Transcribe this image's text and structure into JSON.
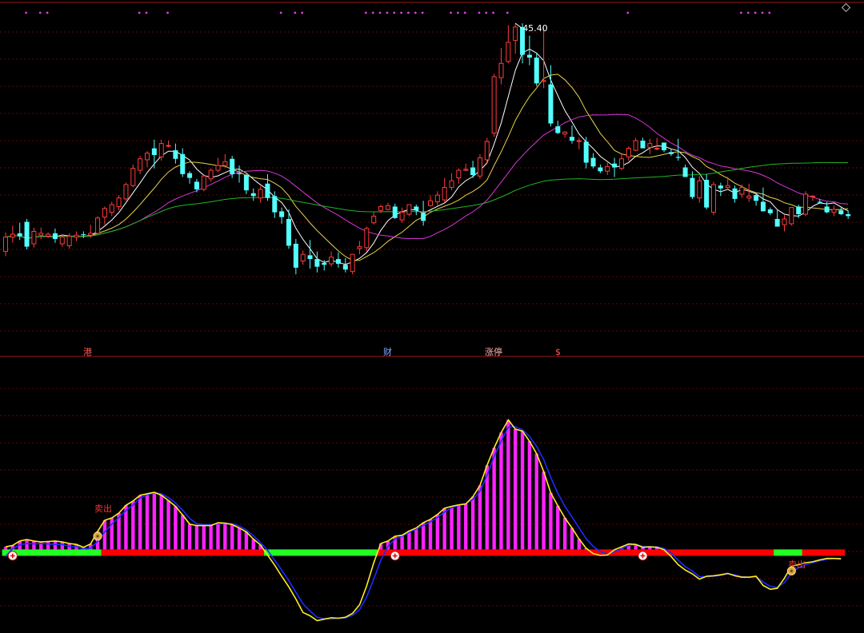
{
  "chart_data": [
    {
      "type": "candlestick",
      "panel": "price",
      "peak_label": "45.40",
      "ylim": [
        11,
        47
      ],
      "candles": [
        [
          21.5,
          23.5,
          21,
          23
        ],
        [
          23,
          24.2,
          22.4,
          23.3
        ],
        [
          23.4,
          24.5,
          22.7,
          23.1
        ],
        [
          24.6,
          24.9,
          21.7,
          22
        ],
        [
          22.3,
          24,
          21.9,
          23.6
        ],
        [
          23.2,
          24,
          22.8,
          23.4
        ],
        [
          23.1,
          23.5,
          22.9,
          23.3
        ],
        [
          23.4,
          23.9,
          22.4,
          22.8
        ],
        [
          22.3,
          23.2,
          22,
          23
        ],
        [
          22.1,
          23.4,
          21.8,
          23.1
        ],
        [
          23,
          23.6,
          22.6,
          23.2
        ],
        [
          23.3,
          23.6,
          22.9,
          23.2
        ],
        [
          23.2,
          24.3,
          22.9,
          23.4
        ],
        [
          23.4,
          25.2,
          23.3,
          25
        ],
        [
          25.1,
          26.2,
          24.3,
          26
        ],
        [
          25.6,
          26.7,
          25.2,
          26.4
        ],
        [
          26.2,
          27.4,
          25.8,
          27.1
        ],
        [
          27,
          28.7,
          26.8,
          28.5
        ],
        [
          28.4,
          30.6,
          28.2,
          30.2
        ],
        [
          30,
          31.5,
          29.6,
          31.2
        ],
        [
          31.1,
          32,
          30.3,
          31.8
        ],
        [
          32.3,
          33.2,
          30.2,
          31.6
        ],
        [
          31.4,
          33.2,
          31,
          32.8
        ],
        [
          32.6,
          33.1,
          32.4,
          32.6
        ],
        [
          32.1,
          32.8,
          30.7,
          31.2
        ],
        [
          31.7,
          32.3,
          29.3,
          29.6
        ],
        [
          29.7,
          29.9,
          28.6,
          29.2
        ],
        [
          28.8,
          29.1,
          27.7,
          28
        ],
        [
          28,
          29.6,
          27.8,
          29.4
        ],
        [
          29.1,
          30.2,
          28.8,
          30
        ],
        [
          30,
          31.3,
          29.8,
          30.5
        ],
        [
          30.5,
          31.7,
          30.3,
          30.9
        ],
        [
          31.2,
          31.5,
          29.2,
          29.6
        ],
        [
          29.7,
          30.5,
          28.7,
          29.6
        ],
        [
          29.5,
          29.6,
          27.5,
          27.9
        ],
        [
          27.6,
          28.1,
          26.8,
          27.3
        ],
        [
          27.1,
          28.3,
          26.6,
          28
        ],
        [
          28.6,
          29.6,
          26.8,
          27.1
        ],
        [
          27.3,
          27.8,
          25,
          25.6
        ],
        [
          25.7,
          26.1,
          24.4,
          25.1
        ],
        [
          24.9,
          25.9,
          21.8,
          22.1
        ],
        [
          22.3,
          22.8,
          19.1,
          19.8
        ],
        [
          20.5,
          21.6,
          20.1,
          21.2
        ],
        [
          21.1,
          22.7,
          19.7,
          20.7
        ],
        [
          20.7,
          21.5,
          19.3,
          19.9
        ],
        [
          20.3,
          20.6,
          19.5,
          20.1
        ],
        [
          20.2,
          21.5,
          19.9,
          20.9
        ],
        [
          20.7,
          21.4,
          19.8,
          20.2
        ],
        [
          20.1,
          20.8,
          19.3,
          19.6
        ],
        [
          19.4,
          21.1,
          19.1,
          21.2
        ],
        [
          21.8,
          22.6,
          21.2,
          22
        ],
        [
          21.9,
          24.1,
          21.5,
          23.9
        ],
        [
          24.5,
          25.6,
          24.3,
          25.2
        ],
        [
          25.8,
          26.4,
          25.5,
          26.2
        ],
        [
          25.9,
          26.6,
          25.8,
          26.3
        ],
        [
          26.2,
          26.5,
          24.9,
          25
        ],
        [
          24.8,
          26.1,
          24.5,
          25.6
        ],
        [
          25.4,
          26.3,
          25.2,
          26.4
        ],
        [
          26.2,
          26.4,
          25.3,
          25.8
        ],
        [
          25.5,
          26.8,
          24.2,
          24.7
        ],
        [
          26.3,
          27.4,
          26.2,
          26.8
        ],
        [
          26.7,
          27.8,
          26.3,
          27.4
        ],
        [
          26.9,
          29.2,
          26.6,
          28.2
        ],
        [
          28.2,
          29.7,
          27.9,
          28.9
        ],
        [
          29.2,
          30.2,
          28.6,
          30
        ],
        [
          30,
          30.7,
          29.9,
          30.1
        ],
        [
          30.3,
          31,
          29.2,
          29.5
        ],
        [
          29.4,
          31.7,
          29.1,
          31.3
        ],
        [
          31.1,
          33.4,
          30.8,
          33
        ],
        [
          33.9,
          40.1,
          33.5,
          39.8
        ],
        [
          39.7,
          42.8,
          39,
          41.2
        ],
        [
          41.4,
          45.2,
          41.2,
          43.4
        ],
        [
          43.6,
          45.4,
          42.2,
          45
        ],
        [
          45,
          45.4,
          41.2,
          42.1
        ],
        [
          42.1,
          44.1,
          41,
          41.8
        ],
        [
          41.8,
          42.3,
          38.8,
          39.1
        ],
        [
          39.3,
          45,
          38.6,
          39.4
        ],
        [
          39,
          41,
          34.6,
          34.9
        ],
        [
          34.6,
          35.2,
          33.8,
          33.9
        ],
        [
          33.8,
          34.1,
          33.4,
          34
        ],
        [
          33.5,
          34.7,
          32.8,
          33.1
        ],
        [
          33.1,
          33.4,
          32.2,
          33.1
        ],
        [
          33,
          33.5,
          30.2,
          30.8
        ],
        [
          31.3,
          31.8,
          30.2,
          30.4
        ],
        [
          30.3,
          30.6,
          29.7,
          29.9
        ],
        [
          29.9,
          30.8,
          29.5,
          30.4
        ],
        [
          30.7,
          31.3,
          29.3,
          30.3
        ],
        [
          30.2,
          31.8,
          30,
          31.2
        ],
        [
          31.4,
          32.5,
          31,
          32.3
        ],
        [
          32.1,
          33.4,
          32,
          33.1
        ],
        [
          33.1,
          33.4,
          32.5,
          32.3
        ],
        [
          32.4,
          33.3,
          31.7,
          32.8
        ],
        [
          32.3,
          33.4,
          32.1,
          32.3
        ],
        [
          32.9,
          32.9,
          31.9,
          32.1
        ],
        [
          31.9,
          32.2,
          31.5,
          31.7
        ],
        [
          31.4,
          33.3,
          31,
          31.3
        ],
        [
          30.3,
          30.6,
          29.3,
          29.3
        ],
        [
          29.2,
          29.9,
          27,
          27.2
        ],
        [
          27.1,
          29.4,
          26.6,
          28.9
        ],
        [
          29,
          29.6,
          25.9,
          26.1
        ],
        [
          25.6,
          28.8,
          25.3,
          28.5
        ],
        [
          28.4,
          28.7,
          27.3,
          28.1
        ],
        [
          28.2,
          29.3,
          27.9,
          28.4
        ],
        [
          28.1,
          28.4,
          26.6,
          27
        ],
        [
          27.5,
          28.5,
          27.1,
          28.2
        ],
        [
          27.1,
          28.6,
          26.7,
          27.3
        ],
        [
          27.4,
          27.6,
          26.3,
          26.8
        ],
        [
          26.7,
          28.2,
          25.7,
          25.7
        ],
        [
          25.9,
          26.1,
          25.3,
          25.5
        ],
        [
          24.9,
          25.9,
          24.1,
          24.1
        ],
        [
          24.3,
          25.3,
          23.6,
          24.9
        ],
        [
          24.4,
          26.1,
          24.2,
          26.1
        ],
        [
          26.2,
          26.4,
          25,
          25.4
        ],
        [
          25.4,
          27.8,
          25.2,
          27.5
        ],
        [
          27.3,
          27.3,
          26.8,
          27.3
        ],
        [
          26.7,
          27,
          26.5,
          26.6
        ],
        [
          26.2,
          26.7,
          25.5,
          25.6
        ],
        [
          25.6,
          26.3,
          25.2,
          25.9
        ],
        [
          25.8,
          26.1,
          25.3,
          25.4
        ],
        [
          25.4,
          25.8,
          24.9,
          25.2
        ]
      ],
      "series": [
        {
          "color": "#ffffff"
        },
        {
          "color": "#e6d24a"
        },
        {
          "color": "#d837d8"
        },
        {
          "color": "#22b522"
        }
      ]
    },
    {
      "type": "bar",
      "panel": "indicator",
      "ylim": [
        -16,
        40
      ],
      "values": [
        1.2,
        1.5,
        2.4,
        2.7,
        2.4,
        2.2,
        2.3,
        2.4,
        2.2,
        1.9,
        1.7,
        1.1,
        1.8,
        4.4,
        6.7,
        7.2,
        8.2,
        9.8,
        10.7,
        11.9,
        12.2,
        12.5,
        11.9,
        10.8,
        9.6,
        7.8,
        5.9,
        5.6,
        5.6,
        5.6,
        6.2,
        6.1,
        5.8,
        5.1,
        4.3,
        2.8,
        1.6,
        -0.5,
        -2.6,
        -4.9,
        -7.1,
        -9.6,
        -12.4,
        -13.1,
        -14.1,
        -13.8,
        -13.5,
        -13.6,
        -13.4,
        -12.6,
        -10.8,
        -6.9,
        -2.1,
        1.9,
        2.4,
        3.4,
        3.6,
        4.5,
        5.1,
        6.2,
        6.9,
        7.9,
        9.2,
        9.6,
        9.9,
        10.1,
        11.6,
        13.9,
        18.1,
        21.7,
        24.9,
        27.5,
        25.6,
        25.2,
        23.1,
        20.5,
        16.8,
        12.4,
        9.7,
        7.2,
        5.1,
        2.8,
        0.9,
        -0.2,
        -0.6,
        -0.5,
        0.6,
        1.2,
        1.8,
        1.7,
        1.1,
        1.2,
        1.1,
        0.6,
        -0.8,
        -2.5,
        -3.6,
        -4.4,
        -5.5,
        -4.9,
        -4.8,
        -4.6,
        -4.3,
        -4.8,
        -5.1,
        -5.1,
        -4.9,
        -6.8,
        -7.6,
        -7.4,
        -5.3,
        -2.8,
        -2.5,
        -2.1,
        -1.9,
        -1.5,
        -1.2,
        -1.2,
        -1.3
      ],
      "signal": [
        -0.8,
        0.8,
        1.6,
        1.9,
        1.8,
        1.9,
        1.8,
        1.7,
        1.7,
        1.3,
        1.2,
        0.8,
        0.9,
        2.3,
        4.3,
        5.9,
        7.3,
        8.7,
        9.9,
        11.3,
        12.0,
        12.4,
        12.2,
        11.4,
        10.3,
        8.8,
        7.1,
        6.0,
        5.8,
        5.8,
        6.0,
        6.0,
        6.0,
        5.5,
        4.7,
        3.5,
        2.1,
        0.5,
        -1.6,
        -3.6,
        -5.8,
        -8.2,
        -10.6,
        -12.1,
        -13.4,
        -13.7,
        -13.8,
        -13.6,
        -13.5,
        -13.0,
        -11.8,
        -9.2,
        -5.5,
        -1.6,
        1.3,
        2.8,
        3.4,
        4.2,
        4.9,
        5.6,
        6.4,
        7.3,
        8.4,
        9.3,
        9.8,
        10.2,
        11.0,
        12.7,
        16.0,
        19.9,
        23.1,
        26.0,
        26.1,
        25.5,
        24.1,
        22.0,
        19.3,
        15.6,
        12.3,
        9.6,
        7.4,
        5.1,
        2.9,
        1.3,
        0.2,
        -0.3,
        0.2,
        0.8,
        1.5,
        1.7,
        1.3,
        1.2,
        1.2,
        0.9,
        -0.1,
        -1.6,
        -2.9,
        -3.8,
        -5.0,
        -5.0,
        -4.9,
        -4.7,
        -4.4,
        -4.6,
        -5.0,
        -5.1,
        -5.0,
        -6.1,
        -7.0,
        -7.2,
        -6.2,
        -4.2,
        -3.1,
        -2.5,
        -2.1,
        -1.7,
        -1.4,
        -1.2,
        -1.2
      ]
    }
  ],
  "annotations": {
    "marker_gang": "港",
    "marker_cai": "财",
    "marker_zhangting": "涨停",
    "marker_dollar": "$",
    "label_maichu": "卖出",
    "label_maochu": "卖出"
  }
}
